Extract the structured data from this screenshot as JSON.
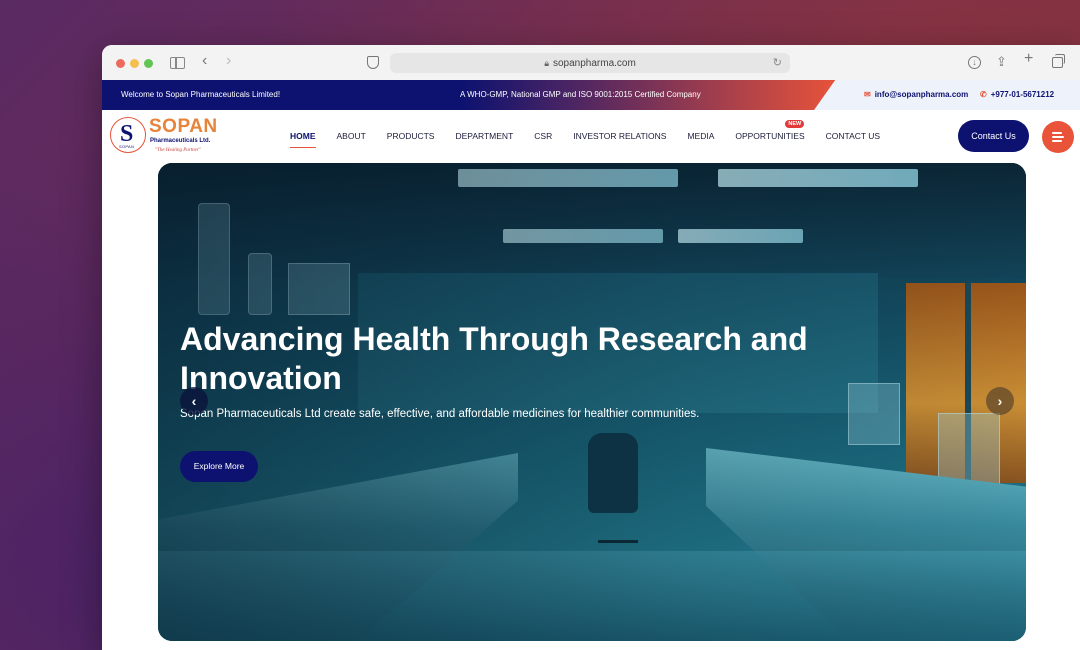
{
  "browser": {
    "url": "sopanpharma.com"
  },
  "topbar": {
    "welcome": "Welcome to Sopan Pharmaceuticals Limited!",
    "certification": "A WHO-GMP, National GMP and ISO 9001:2015 Certified Company",
    "email": "info@sopanpharma.com",
    "phone": "+977-01-5671212"
  },
  "logo": {
    "name": "SOPAN",
    "subtitle": "Pharmaceuticals Ltd.",
    "tagline": "\"The Healing Partner\"",
    "mark_letter": "S",
    "mark_text": "SOPAN"
  },
  "nav": {
    "items": [
      {
        "label": "HOME",
        "active": true
      },
      {
        "label": "ABOUT"
      },
      {
        "label": "PRODUCTS"
      },
      {
        "label": "DEPARTMENT"
      },
      {
        "label": "CSR"
      },
      {
        "label": "INVESTOR RELATIONS"
      },
      {
        "label": "MEDIA"
      },
      {
        "label": "OPPORTUNITIES",
        "badge": "NEW"
      },
      {
        "label": "CONTACT US"
      }
    ],
    "contact_button": "Contact Us"
  },
  "hero": {
    "title": "Advancing Health Through Research and Innovation",
    "subtitle": "Sopan Pharmaceuticals Ltd create safe, effective, and affordable medicines for healthier communities.",
    "cta": "Explore More",
    "prev_icon": "‹",
    "next_icon": "›"
  },
  "colors": {
    "navy": "#0d1270",
    "orange": "#e8533a",
    "logo_orange": "#e8833a"
  }
}
